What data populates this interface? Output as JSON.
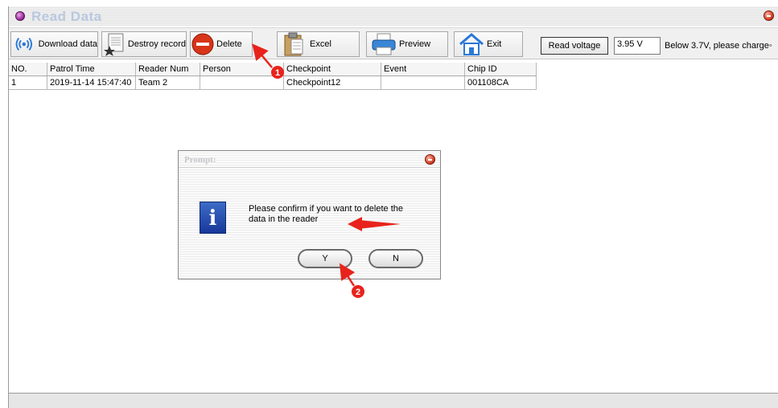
{
  "window": {
    "title": "Read Data"
  },
  "toolbar": {
    "download_label": "Download data",
    "destroy_label": "Destroy record",
    "delete_label": "Delete",
    "excel_label": "Excel",
    "preview_label": "Preview",
    "exit_label": "Exit",
    "read_voltage_label": "Read voltage",
    "voltage_value": "3.95 V",
    "voltage_note": "Below 3.7V, please charge◦"
  },
  "table": {
    "columns": [
      "NO.",
      "Patrol Time",
      "Reader Num",
      "Person",
      "Checkpoint",
      "Event",
      "Chip ID"
    ],
    "rows": [
      [
        "1",
        "2019-11-14 15:47:40",
        "Team 2",
        "",
        "Checkpoint12",
        "",
        "001108CA"
      ]
    ]
  },
  "dialog": {
    "title": "Prompt:",
    "message_line1": "Please confirm if you want to delete the",
    "message_line2": "data in the reader",
    "yes_label": "Y",
    "no_label": "N"
  },
  "annotations": {
    "step1": "1",
    "step2": "2"
  },
  "colors": {
    "annotation_red": "#e8231c",
    "title_faded": "#b9c8df",
    "info_blue": "#2a52b4"
  }
}
